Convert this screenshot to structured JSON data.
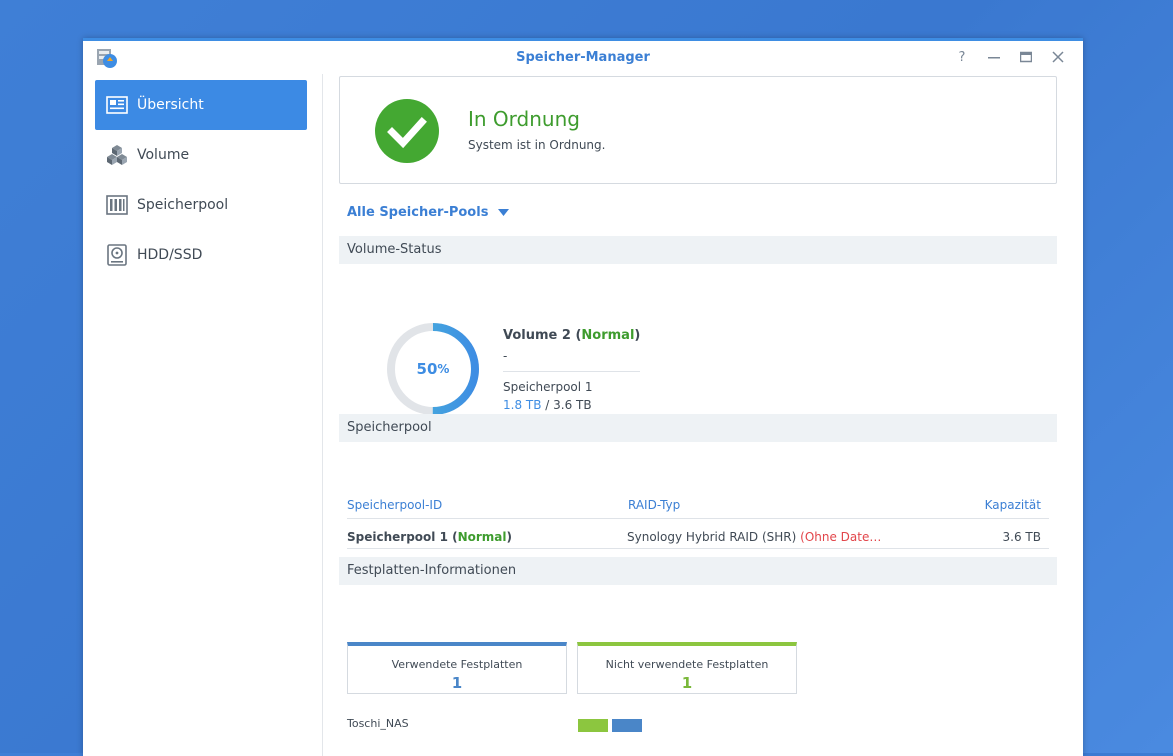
{
  "window": {
    "title": "Speicher-Manager"
  },
  "title_controls": [
    "help-icon",
    "minimize-icon",
    "maximize-icon",
    "close-icon"
  ],
  "sidebar": {
    "items": [
      {
        "label": "Übersicht",
        "icon": "overview-icon",
        "active": true
      },
      {
        "label": "Volume",
        "icon": "cubes-icon",
        "active": false
      },
      {
        "label": "Speicherpool",
        "icon": "storage-pool-icon",
        "active": false
      },
      {
        "label": "HDD/SSD",
        "icon": "hdd-icon",
        "active": false
      }
    ]
  },
  "status": {
    "title": "In Ordnung",
    "subtitle": "System ist in Ordnung.",
    "color": "#3e9c2e"
  },
  "pool_selector": {
    "label": "Alle Speicher-Pools"
  },
  "volume_status": {
    "header": "Volume-Status",
    "usage_percent": 50,
    "usage_number": "50",
    "usage_unit": "%",
    "volume_name": "Volume 2",
    "volume_state": "Normal",
    "description": "-",
    "pool": "Speicherpool 1",
    "used": "1.8 TB",
    "separator": " / ",
    "total": "3.6 TB"
  },
  "storage_pool": {
    "header": "Speicherpool",
    "columns": [
      "Speicherpool-ID",
      "RAID-Typ",
      "Kapazität"
    ],
    "rows": [
      {
        "name": "Speicherpool 1",
        "state": "Normal",
        "raid": "Synology Hybrid RAID (SHR)",
        "raid_note": "(Ohne Date…",
        "capacity": "3.6 TB"
      }
    ]
  },
  "disk_info": {
    "header": "Festplatten-Informationen",
    "used_label": "Verwendete Festplatten",
    "used_count": "1",
    "unused_label": "Nicht verwendete Festplatten",
    "unused_count": "1",
    "nas_name": "Toschi_NAS",
    "used_color": "#4a86c8",
    "unused_color": "#8cc63f"
  }
}
